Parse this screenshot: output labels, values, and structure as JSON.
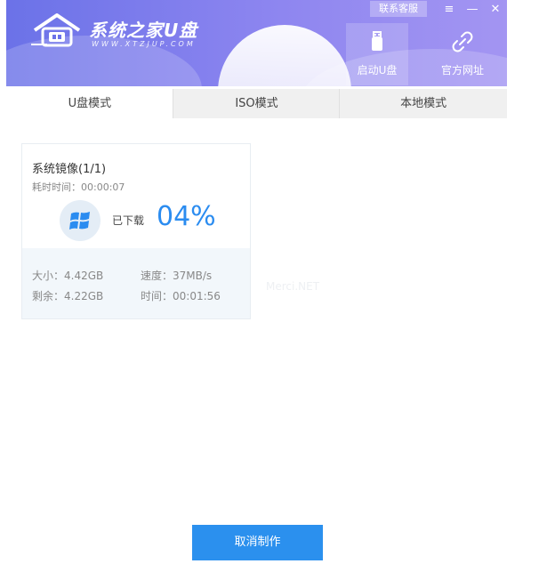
{
  "brand": {
    "title": "系统之家U盘",
    "url": "WWW.XTZJUP.COM"
  },
  "top_controls": {
    "support": "联系客服",
    "menu_glyph": "≡",
    "minimize_glyph": "—",
    "close_glyph": "✕"
  },
  "nav": [
    {
      "label": "启动U盘",
      "icon": "usb-drive-icon",
      "active": true
    },
    {
      "label": "官方网址",
      "icon": "link-icon",
      "active": false
    }
  ],
  "tabs": [
    {
      "label": "U盘模式",
      "active": true
    },
    {
      "label": "ISO模式",
      "active": false
    },
    {
      "label": "本地模式",
      "active": false
    }
  ],
  "task": {
    "title": "系统镜像(1/1)",
    "elapsed": "耗时时间：00:00:07",
    "downloaded_label": "已下载",
    "percent": "04%",
    "size": "大小：4.42GB",
    "speed": "速度：37MB/s",
    "remaining": "剩余：4.22GB",
    "time": "时间：00:01:56"
  },
  "watermark": "Merci.NET",
  "cancel_button": "取消制作",
  "colors": {
    "header_start": "#6b72e8",
    "header_end": "#a395f2",
    "accent_blue": "#2b8cf0",
    "button_blue": "#2b90ee"
  }
}
